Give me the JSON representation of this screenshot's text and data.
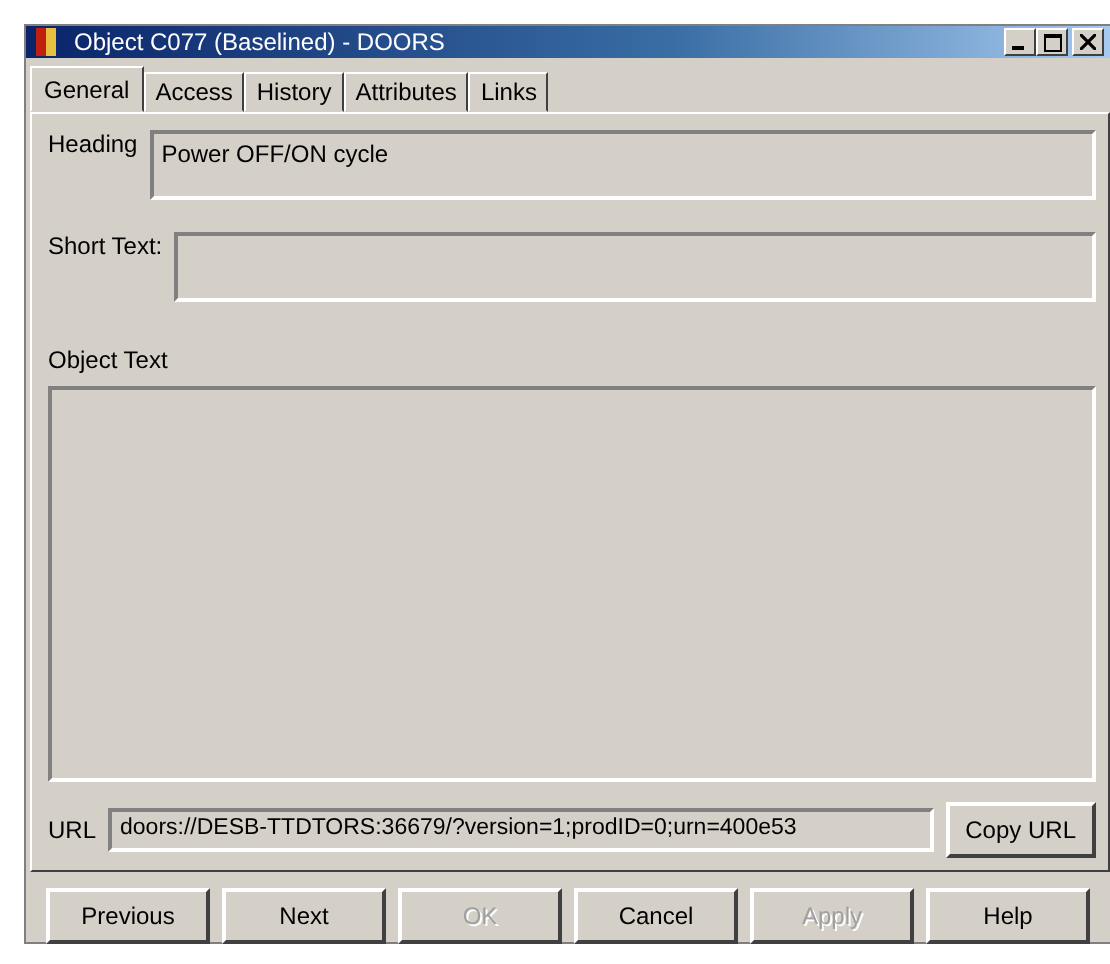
{
  "window": {
    "title": "Object C077 (Baselined) - DOORS"
  },
  "tabs": [
    {
      "label": "General",
      "selected": true
    },
    {
      "label": "Access",
      "selected": false
    },
    {
      "label": "History",
      "selected": false
    },
    {
      "label": "Attributes",
      "selected": false
    },
    {
      "label": "Links",
      "selected": false
    }
  ],
  "heading": {
    "label": "Heading",
    "value": "Power OFF/ON cycle"
  },
  "short_text": {
    "label": "Short Text:"
  },
  "object_text": {
    "label": "Object Text"
  },
  "url": {
    "label": "URL",
    "value": "doors://DESB-TTDTORS:36679/?version=1;prodID=0;urn=400e53",
    "button": "Copy URL"
  },
  "buttons": [
    {
      "label": "Previous",
      "disabled": false
    },
    {
      "label": "Next",
      "disabled": false
    },
    {
      "label": "OK",
      "disabled": true
    },
    {
      "label": "Cancel",
      "disabled": false
    },
    {
      "label": "Apply",
      "disabled": true
    },
    {
      "label": "Help",
      "disabled": false
    }
  ]
}
